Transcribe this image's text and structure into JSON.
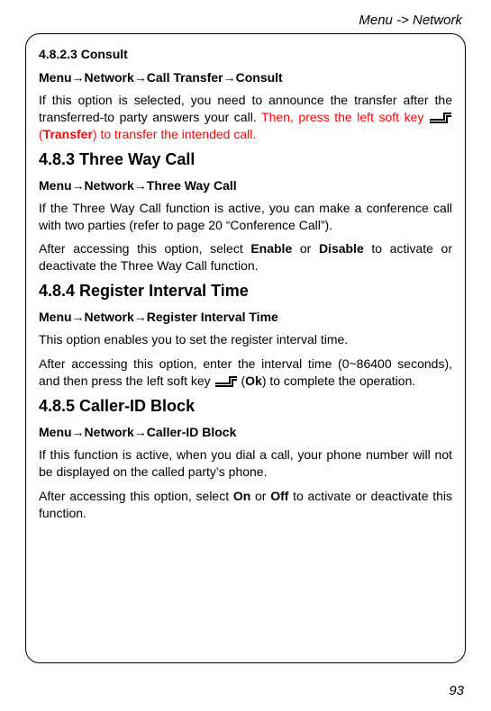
{
  "header": {
    "breadcrumb": "Menu -> Network"
  },
  "s1": {
    "num": "4.8.2.3 Consult",
    "crumb": "Menu→Network→Call Transfer→Consult",
    "p1a": "If this option is selected, you need to announce the transfer after the transferred-to party answers your call. ",
    "p1b_red_pre": "Then, press the left soft key ",
    "p1b_red_post_open": " (",
    "p1b_red_bold": "Transfer",
    "p1b_red_close": ") to transfer the intended call."
  },
  "s2": {
    "title": "4.8.3 Three Way Call",
    "crumb": "Menu→Network→Three Way Call",
    "p1": "If the Three Way Call function is active, you can make a conference call with two parties (refer to page 20 “Conference Call”).",
    "p2a": "After accessing this option, select ",
    "p2_enable": "Enable",
    "p2_or": " or ",
    "p2_disable": "Disable",
    "p2b": " to activate or deactivate the Three Way Call function."
  },
  "s3": {
    "title": "4.8.4 Register Interval Time",
    "crumb": "Menu→Network→Register Interval Time",
    "p1": "This option enables you to set the register interval time.",
    "p2a": "After accessing this option, enter the interval time (0~86400 seconds), and then press the left soft key ",
    "p2b_open": " (",
    "p2_ok": "Ok",
    "p2b_close": ") to complete the operation."
  },
  "s4": {
    "title": "4.8.5 Caller-ID Block",
    "crumb": "Menu→Network→Caller-ID Block",
    "p1": "If this function is active, when you dial a call, your phone number will not be displayed on the called party’s phone.",
    "p2a": "After accessing this option, select ",
    "p2_on": "On",
    "p2_or": " or ",
    "p2_off": "Off",
    "p2b": " to activate or deactivate this function."
  },
  "page": {
    "number": "93"
  }
}
